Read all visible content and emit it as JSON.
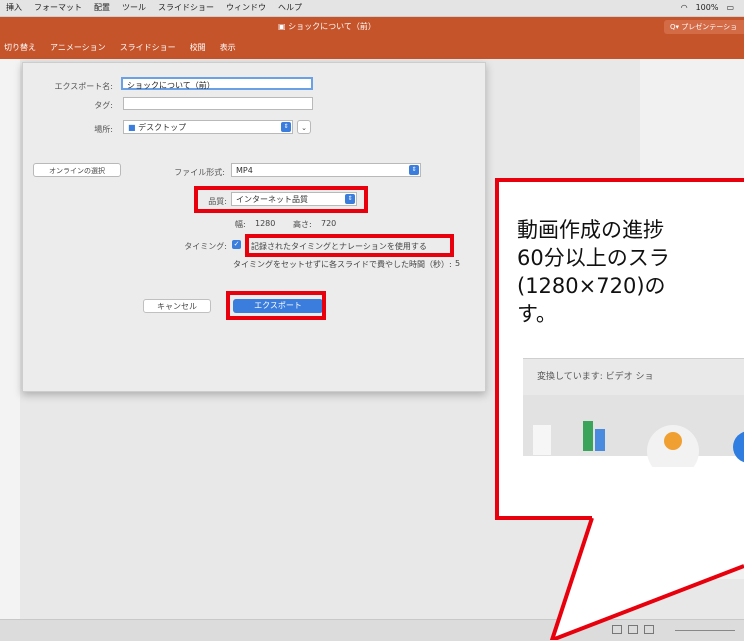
{
  "menubar": {
    "items": [
      "挿入",
      "フォーマット",
      "配置",
      "ツール",
      "スライドショー",
      "ウィンドウ",
      "ヘルプ"
    ],
    "status": [
      "100%"
    ]
  },
  "titlebar": {
    "doc_title": "ショックについて（前）",
    "search_placeholder": "Q▾ プレゼンテーション内"
  },
  "ribbon": {
    "tabs": [
      "切り替え",
      "アニメーション",
      "スライドショー",
      "校閲",
      "表示"
    ]
  },
  "dialog": {
    "export_as_label": "エクスポート名:",
    "export_as_value": "ショックについて（前）",
    "tags_label": "タグ:",
    "tags_value": "",
    "where_label": "場所:",
    "where_value": "デスクトップ",
    "online_button": "オンラインの選択",
    "file_format_label": "ファイル形式:",
    "file_format_value": "MP4",
    "quality_label": "品質:",
    "quality_value": "インターネット品質",
    "width_label": "幅:",
    "width_value": "1280",
    "height_label": "高さ:",
    "height_value": "720",
    "timing_label": "タイミング:",
    "timing_checkbox_label": "記録されたタイミングとナレーションを使用する",
    "timing_note": "タイミングをセットせずに各スライドで費やした時間（秒）:",
    "timing_seconds": "5",
    "cancel_label": "キャンセル",
    "export_label": "エクスポート"
  },
  "callout": {
    "line1": "動画作成の進捗",
    "line2": "60分以上のスラ",
    "line3": "(1280×720)の",
    "line4": "す。",
    "inset_text": "変換しています: ビデオ ショ"
  },
  "colors": {
    "accent": "#c5542b",
    "highlight": "#e8000d",
    "button_blue": "#3b7ddd"
  }
}
